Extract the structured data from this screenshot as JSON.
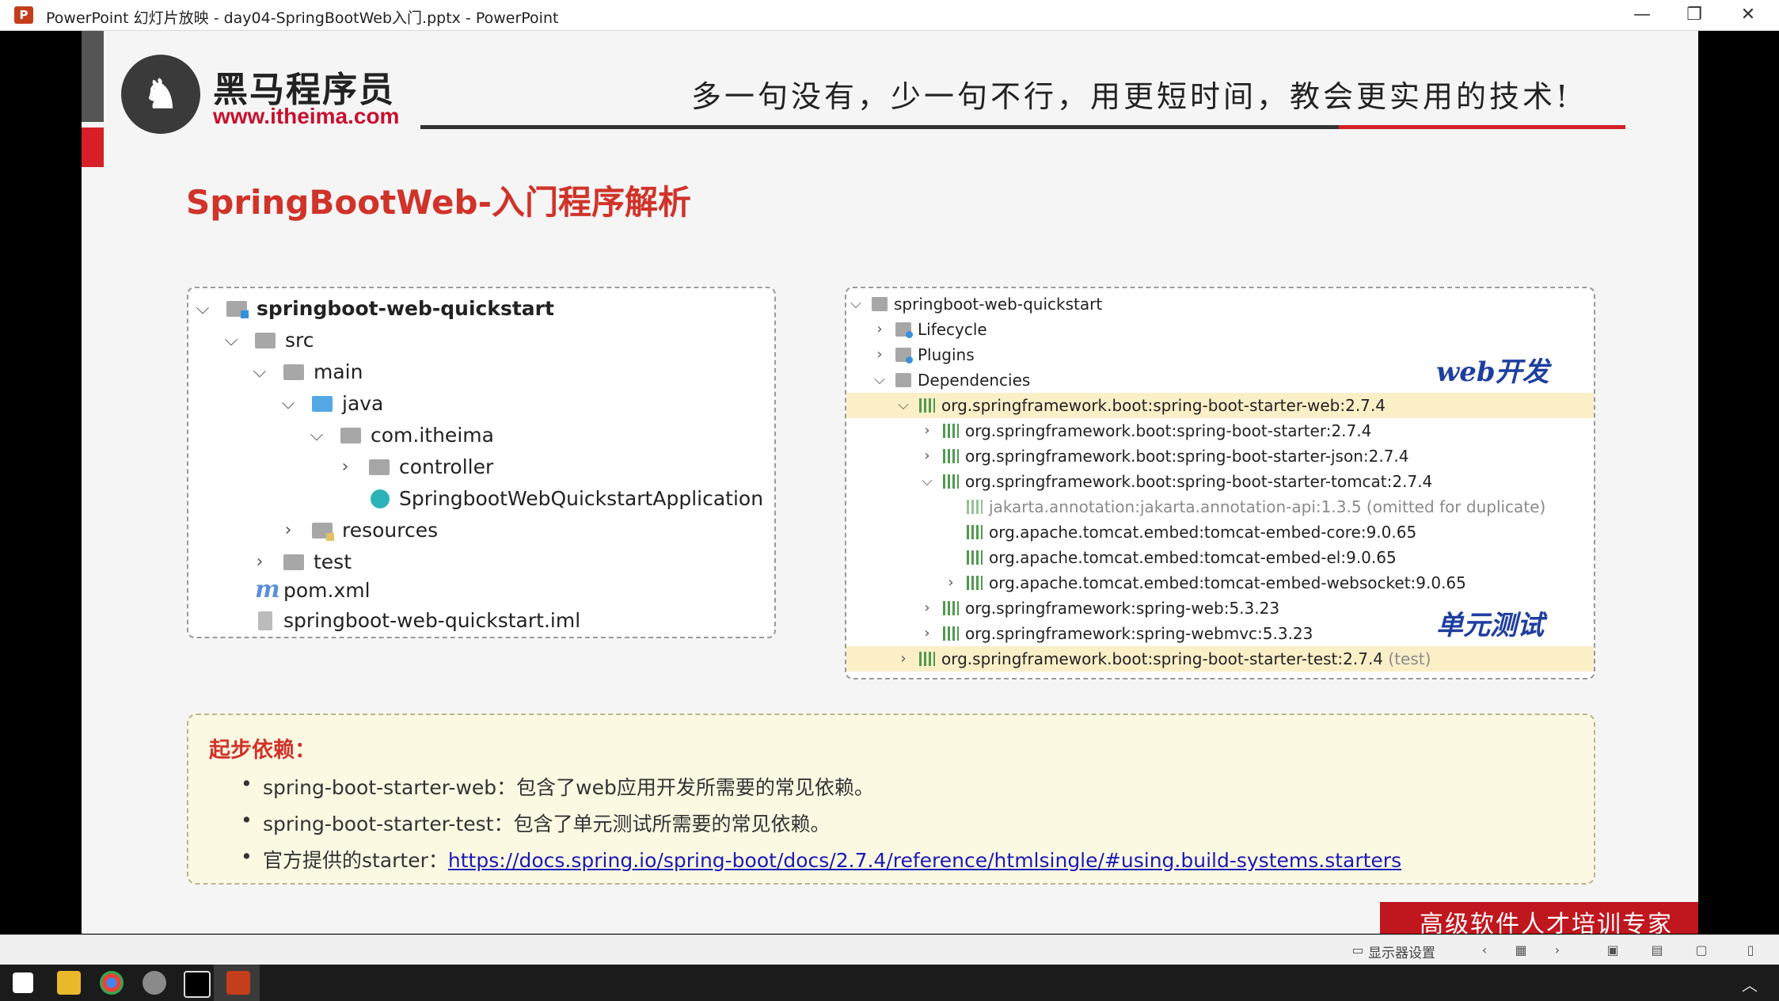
{
  "window": {
    "title": "PowerPoint 幻灯片放映  -  day04-SpringBootWeb入门.pptx - PowerPoint",
    "logo_letter": "P",
    "minimize": "—",
    "restore": "❐",
    "close": "✕"
  },
  "slide": {
    "logo_cn": "黑马程序员",
    "logo_url": "www.itheima.com",
    "slogan": "多一句没有，少一句不行，用更短时间，教会更实用的技术!",
    "heading": "SpringBootWeb-入门程序解析",
    "project_tree": [
      {
        "label": "springboot-web-quickstart",
        "chevron": "⌵",
        "icon": "module-icon"
      },
      {
        "label": "src",
        "chevron": "⌵",
        "icon": "folder-icon"
      },
      {
        "label": "main",
        "chevron": "⌵",
        "icon": "folder-icon"
      },
      {
        "label": "java",
        "chevron": "⌵",
        "icon": "folder-icon"
      },
      {
        "label": "com.itheima",
        "chevron": "⌵",
        "icon": "package-icon"
      },
      {
        "label": "controller",
        "chevron": "›",
        "icon": "package-icon"
      },
      {
        "label": "SpringbootWebQuickstartApplication",
        "chevron": "",
        "icon": "spring-class-icon"
      },
      {
        "label": "resources",
        "chevron": "›",
        "icon": "resources-folder-icon"
      },
      {
        "label": "test",
        "chevron": "›",
        "icon": "folder-icon"
      },
      {
        "label": "pom.xml",
        "chevron": "",
        "icon": "maven-icon",
        "glyph": "m"
      },
      {
        "label": "springboot-web-quickstart.iml",
        "chevron": "",
        "icon": "iml-file-icon"
      }
    ],
    "maven_tree": [
      {
        "label": "springboot-web-quickstart",
        "chevron": "⌵",
        "icon": "maven-project-icon"
      },
      {
        "label": "Lifecycle",
        "chevron": "›",
        "icon": "lifecycle-icon"
      },
      {
        "label": "Plugins",
        "chevron": "›",
        "icon": "plugins-icon"
      },
      {
        "label": "Dependencies",
        "chevron": "⌵",
        "icon": "dependencies-icon"
      },
      {
        "label": "org.springframework.boot:spring-boot-starter-web:2.7.4",
        "chevron": "⌵",
        "icon": "library-icon"
      },
      {
        "label": "org.springframework.boot:spring-boot-starter:2.7.4",
        "chevron": "›",
        "icon": "library-icon"
      },
      {
        "label": "org.springframework.boot:spring-boot-starter-json:2.7.4",
        "chevron": "›",
        "icon": "library-icon"
      },
      {
        "label": "org.springframework.boot:spring-boot-starter-tomcat:2.7.4",
        "chevron": "⌵",
        "icon": "library-icon"
      },
      {
        "label": "jakarta.annotation:jakarta.annotation-api:1.3.5 (omitted for duplicate)",
        "chevron": "",
        "icon": "library-icon"
      },
      {
        "label": "org.apache.tomcat.embed:tomcat-embed-core:9.0.65",
        "chevron": "",
        "icon": "library-icon"
      },
      {
        "label": "org.apache.tomcat.embed:tomcat-embed-el:9.0.65",
        "chevron": "",
        "icon": "library-icon"
      },
      {
        "label": "org.apache.tomcat.embed:tomcat-embed-websocket:9.0.65",
        "chevron": "›",
        "icon": "library-icon"
      },
      {
        "label": "org.springframework:spring-web:5.3.23",
        "chevron": "›",
        "icon": "library-icon"
      },
      {
        "label": "org.springframework:spring-webmvc:5.3.23",
        "chevron": "›",
        "icon": "library-icon"
      },
      {
        "label": "org.springframework.boot:spring-boot-starter-test:2.7.4",
        "suffix": "(test)",
        "chevron": "›",
        "icon": "library-icon"
      }
    ],
    "annotation_web": "web开发",
    "annotation_test": "单元测试",
    "notes": {
      "title": "起步依赖：",
      "bullet1": "spring-boot-starter-web：包含了web应用开发所需要的常见依赖。",
      "bullet2": "spring-boot-starter-test：包含了单元测试所需要的常见依赖。",
      "bullet3_prefix": "官方提供的starter：",
      "bullet3_link": "https://docs.spring.io/spring-boot/docs/2.7.4/reference/htmlsingle/#using.build-systems.starters"
    },
    "badge": "高级软件人才培训专家"
  },
  "statusbar": {
    "display_settings": "显示器设置",
    "prev": "‹",
    "next": "›"
  },
  "colors": {
    "accent_red": "#d61f26",
    "heading_red": "#d0332a",
    "highlight": "#fbefc8",
    "link": "#1a1ab6"
  }
}
